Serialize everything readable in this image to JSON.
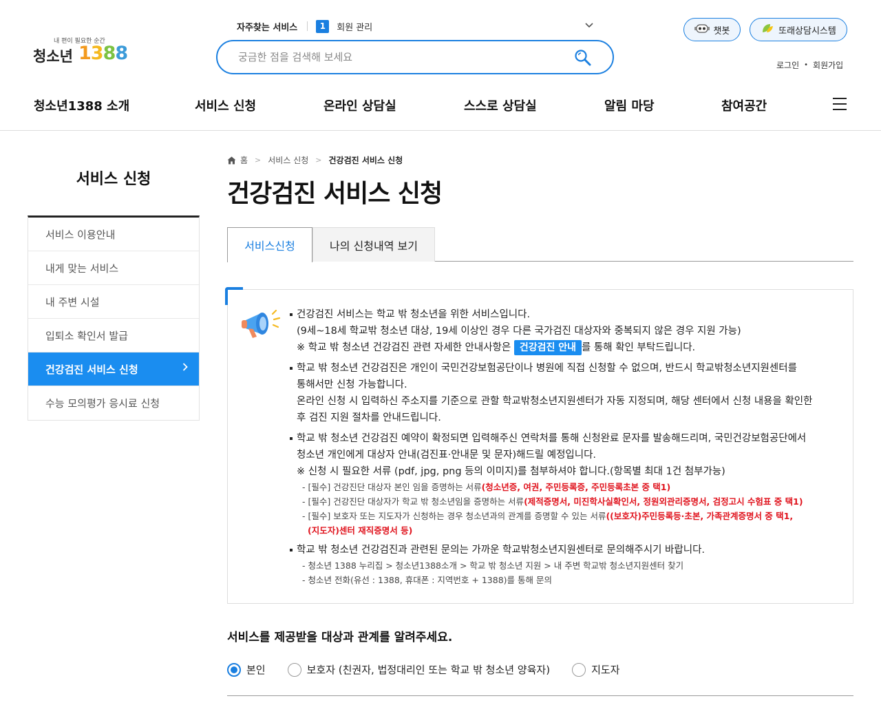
{
  "header": {
    "logo_tagline": "내 편이 필요한 순간",
    "logo_text": "청소년",
    "logo_number": [
      "1",
      "3",
      "8",
      "8"
    ],
    "frequent_label": "자주찾는 서비스",
    "frequent_rank": "1",
    "frequent_item": "회원 관리",
    "search_placeholder": "궁금한 점을 검색해 보세요",
    "chatbot_label": "챗봇",
    "peer_label": "또래상담시스템",
    "login": "로그인",
    "signup": "회원가입"
  },
  "gnb": [
    "청소년1388 소개",
    "서비스 신청",
    "온라인 상담실",
    "스스로 상담실",
    "알림 마당",
    "참여공간"
  ],
  "sidebar": {
    "title": "서비스 신청",
    "items": [
      {
        "label": "서비스 이용안내"
      },
      {
        "label": "내게 맞는 서비스"
      },
      {
        "label": "내 주변 시설"
      },
      {
        "label": "입퇴소 확인서 발급"
      },
      {
        "label": "건강검진 서비스 신청",
        "active": true
      },
      {
        "label": "수능 모의평가 응시료 신청"
      }
    ]
  },
  "breadcrumb": {
    "home": "홈",
    "level1": "서비스 신청",
    "current": "건강검진 서비스 신청"
  },
  "page_title": "건강검진 서비스 신청",
  "tabs": [
    "서비스신청",
    "나의 신청내역 보기"
  ],
  "info": {
    "b1_l1": "건강검진 서비스는 학교 밖 청소년을 위한 서비스입니다.",
    "b1_l2": "(9세~18세 학교밖 청소년 대상, 19세 이상인 경우 다른 국가검진 대상자와 중복되지 않은 경우 지원 가능)",
    "b1_l3_pre": "※ 학교 밖 청소년 건강검진 관련 자세한 안내사항은 ",
    "b1_btn": "건강검진 안내",
    "b1_l3_post": "를 통해 확인 부탁드립니다.",
    "b2_l1": "학교 밖 청소년 건강검진은 개인이 국민건강보험공단이나 병원에 직접 신청할 수 없으며, 반드시 학교밖청소년지원센터를",
    "b2_l2": "통해서만 신청 가능합니다.",
    "b2_l3": "온라인 신청 시 입력하신 주소지를 기준으로 관할 학교밖청소년지원센터가 자동 지정되며, 해당 센터에서 신청 내용을 확인한",
    "b2_l4": "후 검진 지원 절차를 안내드립니다.",
    "b3_l1": "학교 밖 청소년 건강검진 예약이 확정되면 입력해주신 연락처를 통해 신청완료 문자를 발송해드리며, 국민건강보험공단에서",
    "b3_l2": "청소년 개인에게 대상자 안내(검진표·안내문 및 문자)해드릴 예정입니다.",
    "b3_l3": "※ 신청 시 필요한 서류 (pdf, jpg, png 등의 이미지)를 첨부하셔야 합니다.(항목별 최대 1건 첨부가능)",
    "doc1_pre": "- [필수] 건강진단 대상자 본인 임을 증명하는 서류",
    "doc1_red": "(청소년증, 여권, 주민등록증, 주민등록초본 중 택1)",
    "doc2_pre": "- [필수] 건강진단 대상자가 학교 밖 청소년임을 증명하는 서류",
    "doc2_red": "(제적증명서, 미진학사실확인서, 정원외관리증명서, 검정고시 수험표 중 택1)",
    "doc3_pre": "- [필수] 보호자 또는 지도자가 신청하는 경우 청소년과의 관계를 증명할 수 있는 서류",
    "doc3_red": "((보호자)주민등록등·초본, 가족관계증명서 중 택1,",
    "doc3_red2": "(지도자)센터 재직증명서 등)",
    "b4_l1": "학교 밖 청소년 건강검진과 관련된 문의는 가까운 학교밖청소년지원센터로 문의해주시기 바랍니다.",
    "b4_s1": "- 청소년 1388 누리집 > 청소년1388소개 > 학교 밖 청소년 지원 > 내 주변 학교밖 청소년지원센터 찾기",
    "b4_s2": "- 청소년 전화(유선 : 1388, 휴대폰 : 지역번호 + 1388)를 통해 문의"
  },
  "question": "서비스를 제공받을 대상과 관계를 알려주세요.",
  "radios": [
    {
      "label": "본인",
      "checked": true
    },
    {
      "label": "보호자 (친권자, 법정대리인 또는 학교 밖 청소년 양육자)",
      "checked": false
    },
    {
      "label": "지도자",
      "checked": false
    }
  ],
  "colors": {
    "accent": "#1a7fe0",
    "active_menu": "#1a8df0",
    "required_red": "#e0141e"
  }
}
